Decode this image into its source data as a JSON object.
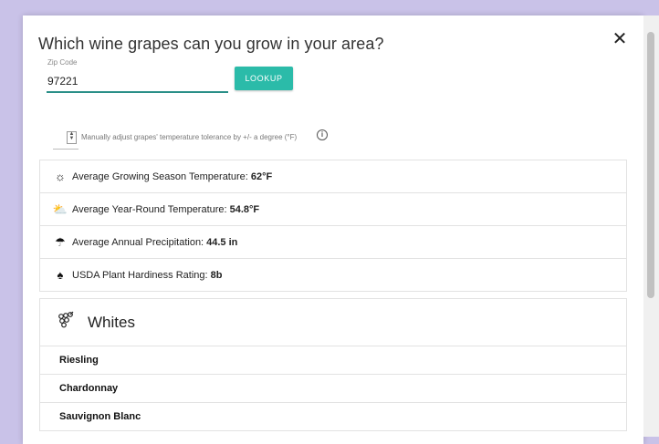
{
  "title": "Which wine grapes can you grow in your area?",
  "close_icon": "close-icon",
  "zip": {
    "label": "Zip Code",
    "value": "97221"
  },
  "lookup_label": "LOOKUP",
  "adjust": {
    "text": "Manually adjust grapes' temperature tolerance by +/- a degree (°F)",
    "stepper_icon": "stepper-icon",
    "info_icon": "info-icon"
  },
  "stats": [
    {
      "icon": "sun-icon",
      "label": "Average Growing Season Temperature:",
      "value": "62°F"
    },
    {
      "icon": "partly-cloudy-icon",
      "label": "Average Year-Round Temperature:",
      "value": "54.8°F"
    },
    {
      "icon": "umbrella-icon",
      "label": "Average Annual Precipitation:",
      "value": "44.5 in"
    },
    {
      "icon": "plant-icon",
      "label": "USDA Plant Hardiness Rating:",
      "value": "8b"
    }
  ],
  "whites": {
    "icon": "grapes-icon",
    "title": "Whites",
    "items": [
      "Riesling",
      "Chardonnay",
      "Sauvignon Blanc"
    ]
  },
  "colors": {
    "accent": "#2bbba9",
    "underline": "#2a8f88",
    "background": "#c9c2e8"
  }
}
